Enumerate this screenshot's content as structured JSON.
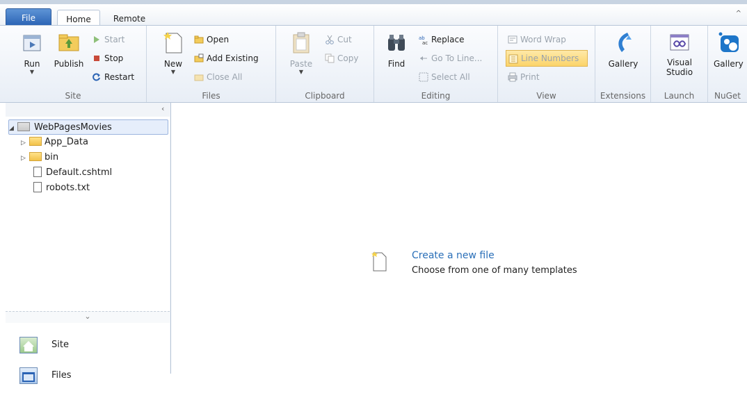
{
  "tabs": {
    "file": "File",
    "home": "Home",
    "remote": "Remote"
  },
  "ribbon": {
    "site": {
      "run": "Run",
      "publish": "Publish",
      "start": "Start",
      "stop": "Stop",
      "restart": "Restart",
      "label": "Site"
    },
    "files": {
      "new": "New",
      "open": "Open",
      "add_existing": "Add Existing",
      "close_all": "Close All",
      "label": "Files"
    },
    "clipboard": {
      "paste": "Paste",
      "cut": "Cut",
      "copy": "Copy",
      "label": "Clipboard"
    },
    "editing": {
      "find": "Find",
      "replace": "Replace",
      "goto": "Go To Line...",
      "select_all": "Select All",
      "label": "Editing"
    },
    "view": {
      "word_wrap": "Word Wrap",
      "line_numbers": "Line Numbers",
      "print": "Print",
      "label": "View"
    },
    "extensions": {
      "gallery": "Gallery",
      "label": "Extensions"
    },
    "launch": {
      "visual_studio": "Visual Studio",
      "label": "Launch"
    },
    "nuget": {
      "gallery": "Gallery",
      "label": "NuGet"
    }
  },
  "tree": {
    "root": "WebPagesMovies",
    "items": [
      "App_Data",
      "bin",
      "Default.cshtml",
      "robots.txt"
    ]
  },
  "nav": {
    "site": "Site",
    "files": "Files"
  },
  "main": {
    "create_title": "Create a new file",
    "create_sub": "Choose from one of many templates"
  },
  "colors": {
    "accent": "#2a6fb8",
    "file_tab": "#2a63b4",
    "highlight": "#fbd46a"
  }
}
